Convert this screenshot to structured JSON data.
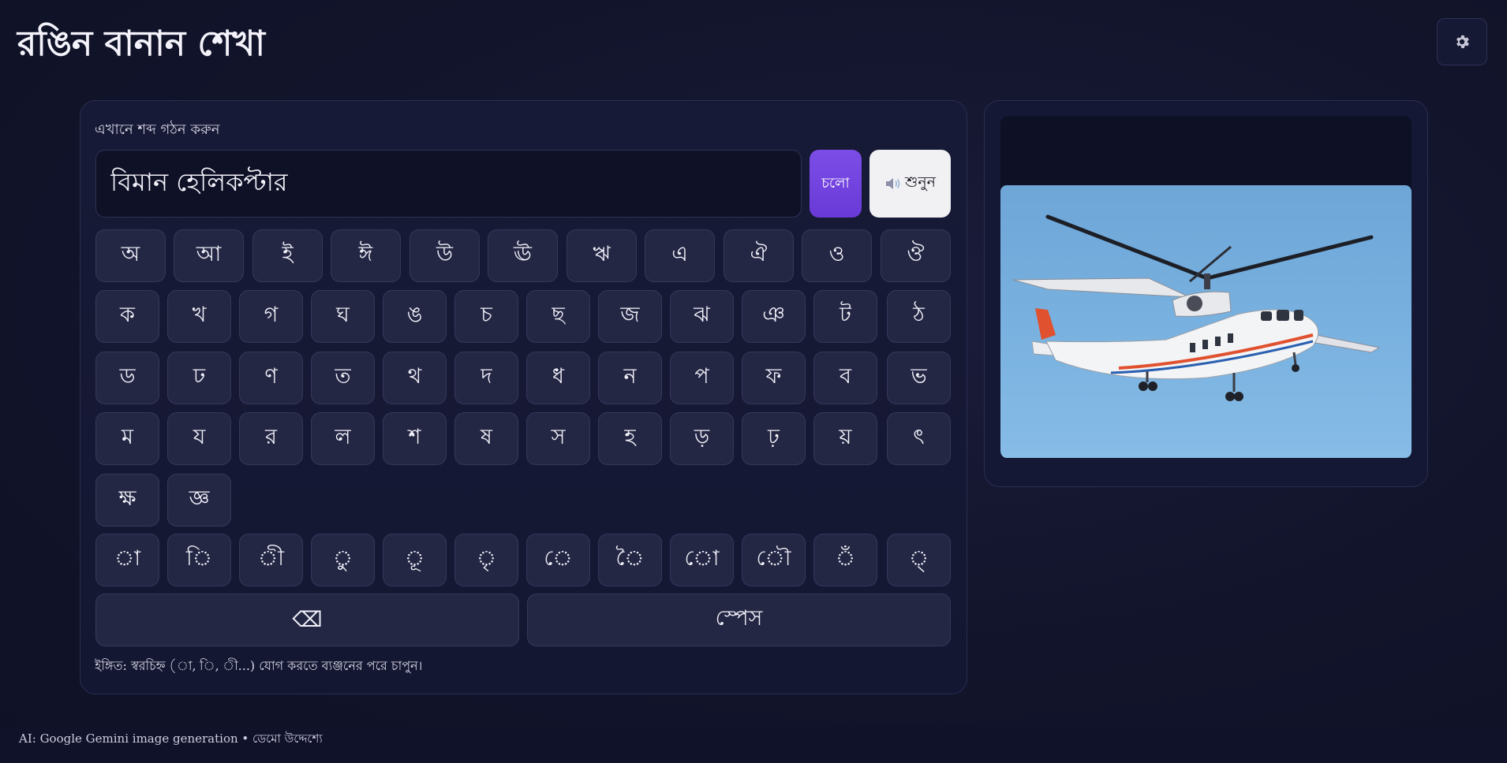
{
  "app": {
    "title": "রঙিন বানান শেখা"
  },
  "settings": {
    "icon": "gear-icon"
  },
  "builder": {
    "label": "এখানে শব্দ গঠন করুন",
    "input_value": "বিমান হেলিকপ্টার",
    "go_label": "চলো",
    "listen_label": "শুনুন",
    "listen_icon": "speaker-icon"
  },
  "keyboard": {
    "vowels": [
      "অ",
      "আ",
      "ই",
      "ঈ",
      "উ",
      "ঊ",
      "ঋ",
      "এ",
      "ঐ",
      "ও",
      "ঔ"
    ],
    "consonants": [
      [
        "ক",
        "খ",
        "গ",
        "ঘ",
        "ঙ",
        "চ",
        "ছ",
        "জ",
        "ঝ",
        "ঞ",
        "ট",
        "ঠ"
      ],
      [
        "ড",
        "ঢ",
        "ণ",
        "ত",
        "থ",
        "দ",
        "ধ",
        "ন",
        "প",
        "ফ",
        "ব",
        "ভ"
      ],
      [
        "ম",
        "য",
        "র",
        "ল",
        "শ",
        "ষ",
        "স",
        "হ",
        "ড়",
        "ঢ়",
        "য়",
        "ৎ"
      ],
      [
        "ক্ষ",
        "জ্ঞ"
      ]
    ],
    "signs": [
      "া",
      "ি",
      "ী",
      "ু",
      "ূ",
      "ৃ",
      "ে",
      "ৈ",
      "ো",
      "ৌ",
      "ঁ",
      "্"
    ],
    "backspace_label": "⌫",
    "space_label": "স্পেস"
  },
  "hint": "ইঙ্গিত: স্বরচিহ্ন (া, ি, ী...) যোগ করতে ব্যঞ্জনের পরে চাপুন।",
  "picture": {
    "subject": "helicopter"
  },
  "footer": {
    "credit": "AI: Google Gemini image generation • ডেমো উদ্দেশ্যে"
  },
  "colors": {
    "accent": "#7c4de6",
    "background": "#12142b",
    "key": "#242744"
  }
}
